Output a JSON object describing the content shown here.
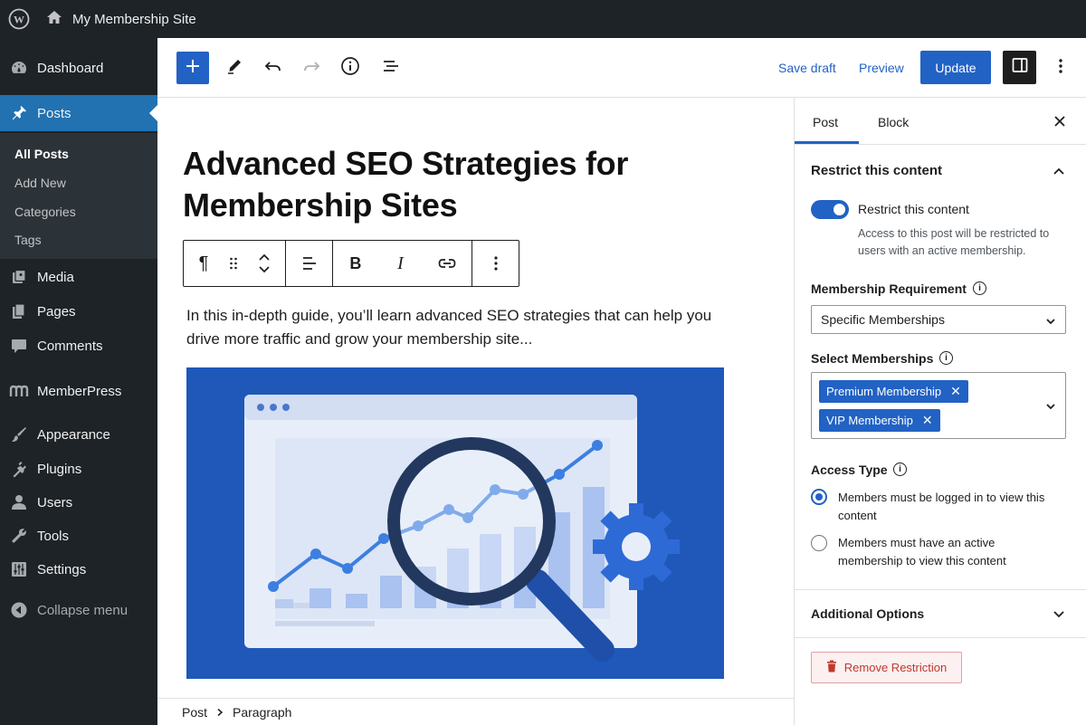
{
  "admin_bar": {
    "site_name": "My Membership Site"
  },
  "sidebar": {
    "items": [
      {
        "label": "Dashboard",
        "icon": "dashboard-icon"
      },
      {
        "label": "Posts",
        "icon": "pin-icon",
        "active": true
      },
      {
        "label": "Media",
        "icon": "media-icon"
      },
      {
        "label": "Pages",
        "icon": "pages-icon"
      },
      {
        "label": "Comments",
        "icon": "comment-icon"
      },
      {
        "label": "MemberPress",
        "icon": "memberpress-icon"
      },
      {
        "label": "Appearance",
        "icon": "brush-icon"
      },
      {
        "label": "Plugins",
        "icon": "plugin-icon"
      },
      {
        "label": "Users",
        "icon": "user-icon"
      },
      {
        "label": "Tools",
        "icon": "wrench-icon"
      },
      {
        "label": "Settings",
        "icon": "settings-icon"
      }
    ],
    "submenu": [
      "All Posts",
      "Add New",
      "Categories",
      "Tags"
    ],
    "collapse_label": "Collapse menu"
  },
  "toolbar": {
    "save_draft": "Save draft",
    "preview": "Preview",
    "update": "Update"
  },
  "editor": {
    "title": "Advanced SEO Strategies for Membership Sites",
    "paragraph": "In this in-depth guide, you’ll learn advanced SEO strategies that can help you drive more traffic and grow your membership site...",
    "block_toolbar": {
      "paragraph_glyph": "¶",
      "bold": "B",
      "italic": "I"
    }
  },
  "panel": {
    "tabs": [
      "Post",
      "Block"
    ],
    "active_tab": "Post",
    "restrict_section_title": "Restrict this content",
    "toggle_label": "Restrict this content",
    "toggle_on": true,
    "toggle_help": "Access to this post will be restricted to users with an active membership.",
    "membership_requirement_label": "Membership Requirement",
    "membership_requirement_value": "Specific Memberships",
    "select_memberships_label": "Select Memberships",
    "selected_memberships": [
      "Premium Membership",
      "VIP Membership"
    ],
    "access_type_label": "Access Type",
    "access_options": [
      {
        "label": "Members must be logged in to view this content",
        "checked": true
      },
      {
        "label": "Members must have an active membership to view this content",
        "checked": false
      }
    ],
    "additional_options_label": "Additional Options",
    "remove_button": "Remove Restriction"
  },
  "breadcrumb": [
    "Post",
    "Paragraph"
  ],
  "colors": {
    "accent": "#2262c4",
    "admin_dark": "#1d2327",
    "danger": "#c0392b"
  }
}
